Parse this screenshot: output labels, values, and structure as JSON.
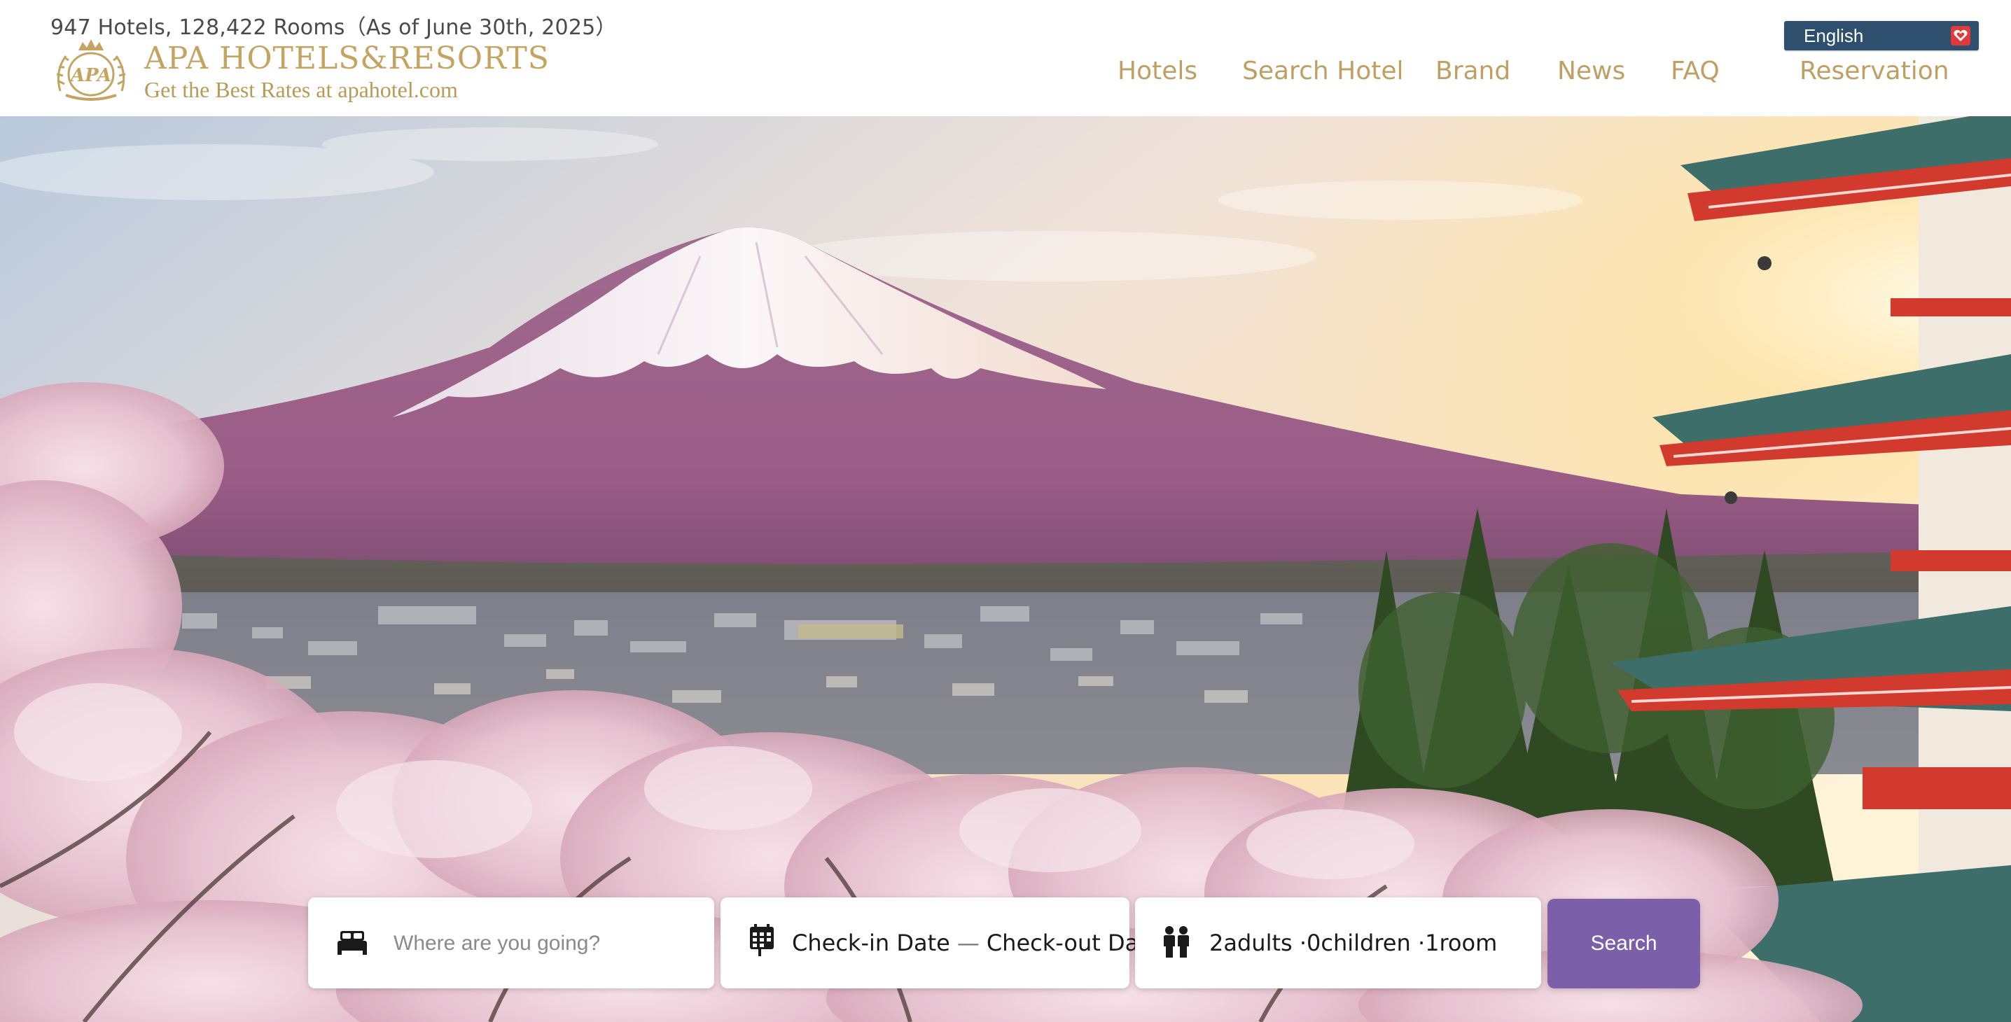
{
  "header": {
    "stats_text": "947 Hotels, 128,422 Rooms（As of June 30th, 2025）",
    "logo": {
      "brand": "APA HOTELS&RESORTS",
      "tagline": "Get the Best Rates at apahotel.com",
      "emblem_text": "APA"
    },
    "language": {
      "selected": "English",
      "icon": "heart-logo-icon"
    },
    "nav": [
      {
        "label": "Hotels"
      },
      {
        "label": "Search Hotel"
      },
      {
        "label": "Brand"
      },
      {
        "label": "News"
      },
      {
        "label": "FAQ"
      },
      {
        "label": "Reservation"
      }
    ]
  },
  "hero": {
    "scene": "mount-fuji-pagoda-cherry-blossoms"
  },
  "search": {
    "destination": {
      "placeholder": "Where are you going?",
      "icon": "bed-icon"
    },
    "dates": {
      "checkin": "Check-in Date",
      "separator": "—",
      "checkout": "Check-out Date",
      "icon": "calendar-icon"
    },
    "guests": {
      "text": "2adults ·0children ·1room",
      "icon": "people-icon"
    },
    "button_label": "Search"
  },
  "colors": {
    "brand_gold": "#bfa064",
    "language_bg": "#2f4f6e",
    "search_button": "#7b5fa8"
  }
}
